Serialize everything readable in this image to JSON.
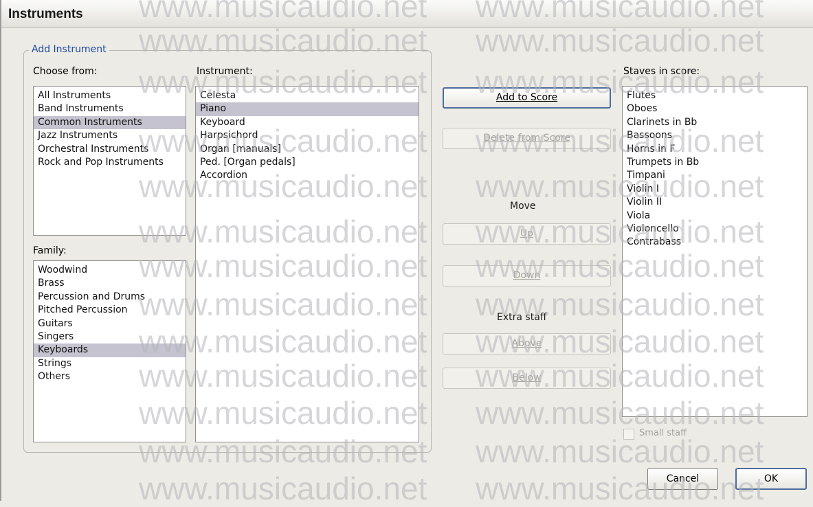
{
  "window": {
    "title": "Instruments"
  },
  "add_instrument": {
    "group_label": "Add Instrument",
    "choose_from_label": "Choose from:",
    "choose_from_items": [
      "All Instruments",
      "Band Instruments",
      "Common Instruments",
      "Jazz Instruments",
      "Orchestral Instruments",
      "Rock and Pop Instruments"
    ],
    "choose_from_selected": "Common Instruments",
    "family_label": "Family:",
    "family_items": [
      "Woodwind",
      "Brass",
      "Percussion and Drums",
      "Pitched Percussion",
      "Guitars",
      "Singers",
      "Keyboards",
      "Strings",
      "Others"
    ],
    "family_selected": "Keyboards",
    "instrument_label": "Instrument:",
    "instrument_items": [
      "Celesta",
      "Piano",
      "Keyboard",
      "Harpsichord",
      "Organ [manuals]",
      "Ped. [Organ pedals]",
      "Accordion"
    ],
    "instrument_selected": "Piano"
  },
  "actions": {
    "add_to_score": "Add to Score",
    "delete_from_score": "Delete from Score",
    "move_label": "Move",
    "up": "Up",
    "down": "Down",
    "extra_staff_label": "Extra staff",
    "above": "Above",
    "below": "Below"
  },
  "staves": {
    "label": "Staves in score:",
    "items": [
      "Flutes",
      "Oboes",
      "Clarinets in Bb",
      "Bassoons",
      "Horns in F",
      "Trumpets in Bb",
      "Timpani",
      "Violin I",
      "Violin II",
      "Viola",
      "Violoncello",
      "Contrabass"
    ],
    "small_staff_label": "Small staff",
    "small_staff_checked": false
  },
  "footer": {
    "cancel": "Cancel",
    "ok": "OK"
  },
  "watermark": {
    "text": "www.musicaudio.net"
  }
}
